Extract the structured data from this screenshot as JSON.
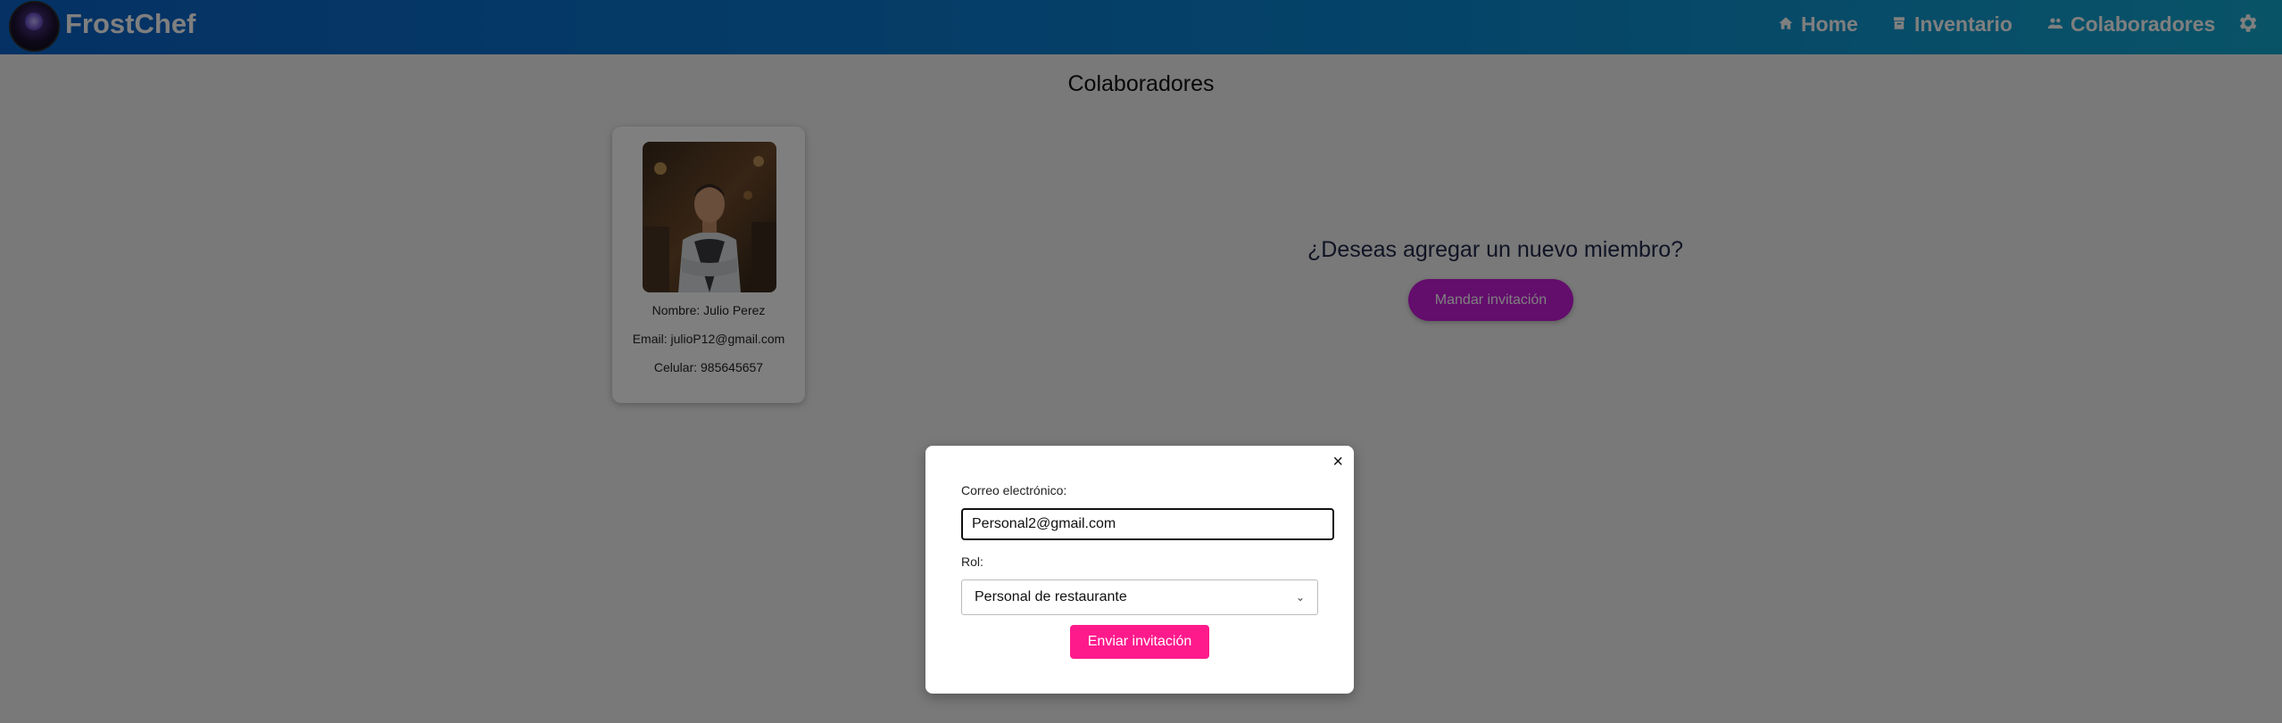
{
  "nav": {
    "brand": "FrostChef",
    "links": [
      {
        "label": "Home",
        "icon": "home-icon"
      },
      {
        "label": "Inventario",
        "icon": "inventory-icon"
      },
      {
        "label": "Colaboradores",
        "icon": "people-icon"
      }
    ],
    "settings_icon": "gear-icon"
  },
  "page": {
    "title": "Colaboradores"
  },
  "collaborator": {
    "name_line": "Nombre: Julio Perez",
    "email_line": "Email: julioP12@gmail.com",
    "phone_line": "Celular: 985645657"
  },
  "invite": {
    "question": "¿Deseas agregar un nuevo miembro?",
    "button": "Mandar invitación"
  },
  "modal": {
    "close_symbol": "×",
    "email_label": "Correo electrónico:",
    "email_value": "Personal2@gmail.com",
    "role_label": "Rol:",
    "role_selected": "Personal de restaurante",
    "submit": "Enviar invitación"
  },
  "colors": {
    "nav_gradient_start": "#0a63c9",
    "nav_gradient_end": "#12a7cf",
    "invite_button": "#c71bd9",
    "send_button": "#ff1a8c"
  }
}
